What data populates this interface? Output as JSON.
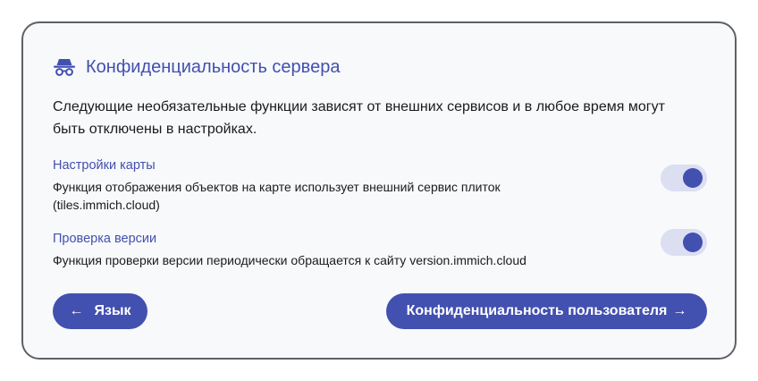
{
  "header": {
    "icon": "incognito-icon",
    "title": "Конфиденциальность сервера"
  },
  "intro": {
    "text": "Следующие необязательные функции зависят от внешних сервисов и в любое время могут быть отключены в настройках."
  },
  "settings": [
    {
      "title": "Настройки карты",
      "description": "Функция отображения объектов на карте использует внешний сервис плиток (tiles.immich.cloud)",
      "enabled": true
    },
    {
      "title": "Проверка версии",
      "description": "Функция проверки версии периодически обращается к сайту version.immich.cloud",
      "enabled": true
    }
  ],
  "nav": {
    "back_arrow": "←",
    "back_label": "Язык",
    "next_label": "Конфиденциальность пользователя",
    "next_arrow": "→"
  },
  "colors": {
    "accent": "#4250af",
    "toggle_track": "#dcdff2",
    "card_bg": "#f8f9fb",
    "card_border": "#5f6166"
  }
}
